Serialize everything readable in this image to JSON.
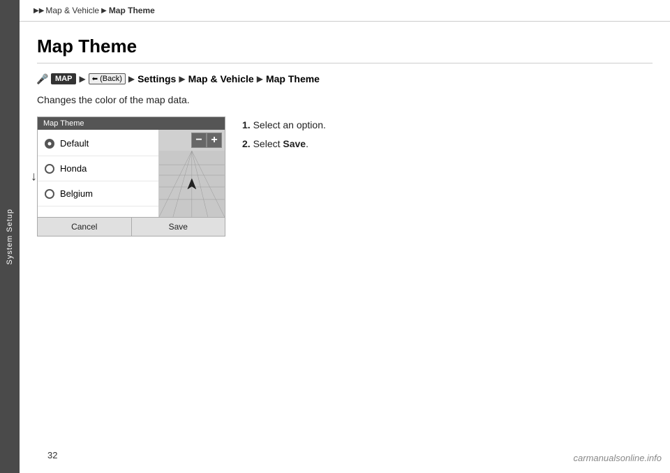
{
  "sidebar": {
    "label": "System Setup"
  },
  "breadcrumb": {
    "arrows": "▶▶",
    "part1": "Map & Vehicle",
    "sep1": "▶",
    "part2": "Map Theme"
  },
  "page": {
    "title": "Map Theme",
    "nav_mic_symbol": "🎤",
    "nav_map_btn": "MAP",
    "nav_back_btn_icon": "BACK",
    "nav_back_label": "(Back)",
    "nav_sep1": "▶",
    "nav_settings": "Settings",
    "nav_sep2": "▶",
    "nav_mapvehicle": "Map & Vehicle",
    "nav_sep3": "▶",
    "nav_maptheme": "Map Theme",
    "body_text": "Changes the color of the map data.",
    "instruction1_num": "1.",
    "instruction1_text": " Select an option.",
    "instruction2_num": "2.",
    "instruction2_pre": " Select ",
    "instruction2_bold": "Save",
    "instruction2_post": "."
  },
  "map_ui": {
    "title": "Map Theme",
    "options": [
      {
        "label": "Default",
        "selected": true
      },
      {
        "label": "Honda",
        "selected": false
      },
      {
        "label": "Belgium",
        "selected": false
      }
    ],
    "btn_cancel": "Cancel",
    "btn_save": "Save"
  },
  "footer": {
    "page_number": "32",
    "watermark": "carmanualsonline.info"
  }
}
